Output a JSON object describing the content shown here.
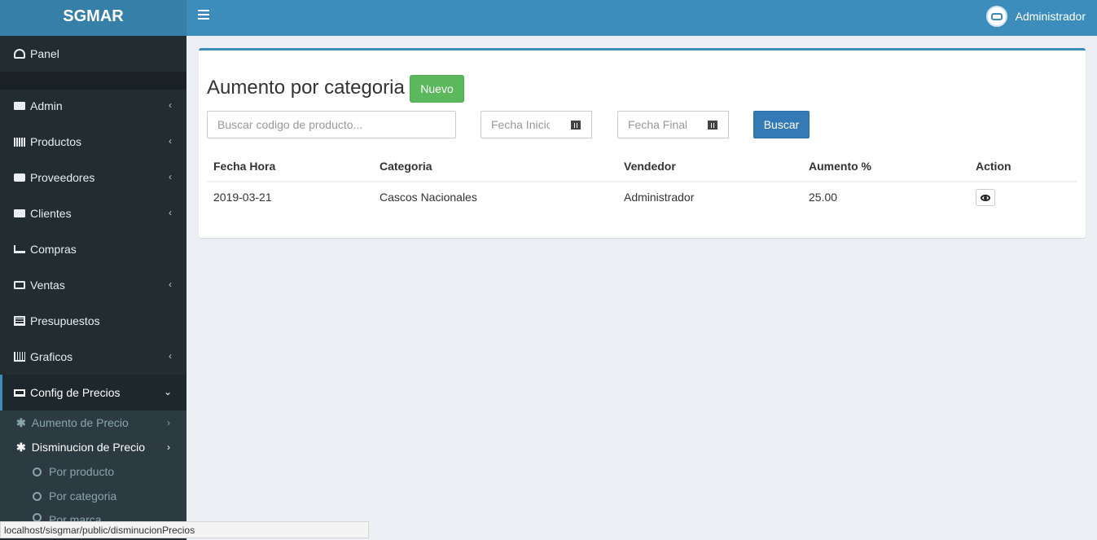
{
  "app": {
    "brand": "SGMAR"
  },
  "header": {
    "user_name": "Administrador"
  },
  "sidebar": {
    "items": [
      {
        "label": "Panel"
      },
      {
        "label": "Admin"
      },
      {
        "label": "Productos"
      },
      {
        "label": "Proveedores"
      },
      {
        "label": "Clientes"
      },
      {
        "label": "Compras"
      },
      {
        "label": "Ventas"
      },
      {
        "label": "Presupuestos"
      },
      {
        "label": "Graficos"
      },
      {
        "label": "Config de Precios"
      }
    ],
    "submenu": {
      "aumento": "Aumento de Precio",
      "disminucion": "Disminucion de Precio",
      "children": [
        "Por producto",
        "Por categoria",
        "Por marca"
      ]
    }
  },
  "page": {
    "title": "Aumento por categoria",
    "new_button": "Nuevo",
    "search_placeholder": "Buscar codigo de producto...",
    "start_date_placeholder": "Fecha Inicio",
    "end_date_placeholder": "Fecha Final",
    "search_button": "Buscar"
  },
  "table": {
    "headers": [
      "Fecha Hora",
      "Categoria",
      "Vendedor",
      "Aumento %",
      "Action"
    ],
    "rows": [
      {
        "fecha": "2019-03-21",
        "categoria": "Cascos Nacionales",
        "vendedor": "Administrador",
        "aumento": "25.00"
      }
    ]
  },
  "statusbar": {
    "url": "localhost/sisgmar/public/disminucionPrecios"
  },
  "colors": {
    "primary": "#3c8dbc",
    "sidebar": "#222d32",
    "success": "#5cb85c",
    "button_primary": "#337ab7"
  }
}
